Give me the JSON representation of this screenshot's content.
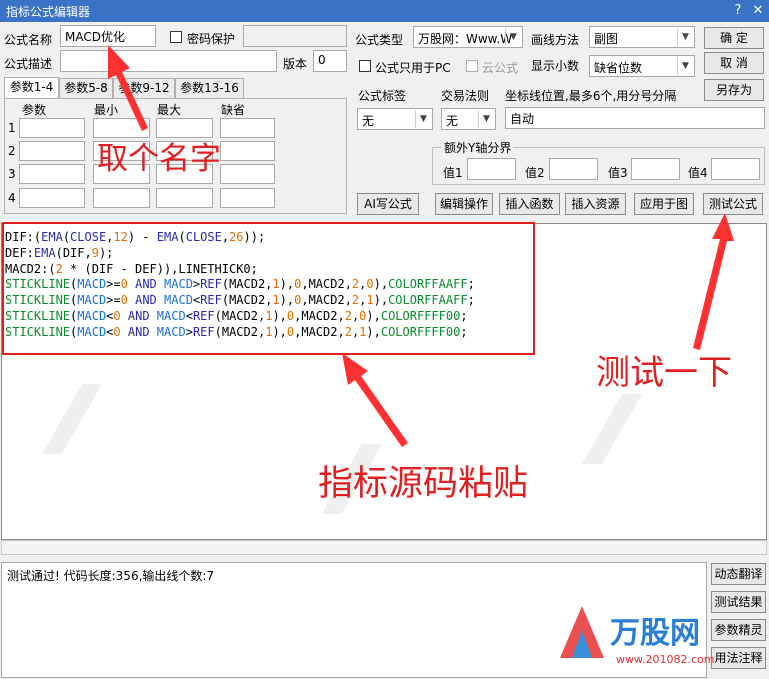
{
  "window": {
    "title": "指标公式编辑器",
    "help_icon": "?",
    "close_icon": "✕"
  },
  "header": {
    "name_label": "公式名称",
    "name_value": "MACD优化",
    "password_label": "密码保护",
    "desc_label": "公式描述",
    "version_label": "版本",
    "version_value": "0",
    "type_label": "公式类型",
    "type_value": "万股网：Www.W",
    "draw_label": "画线方法",
    "draw_value": "副图",
    "pc_only_label": "公式只用于PC",
    "cloud_label": "云公式",
    "decimals_label": "显示小数",
    "decimals_value": "缺省位数"
  },
  "buttons": {
    "ok": "确  定",
    "cancel": "取  消",
    "save_as": "另存为"
  },
  "tabs": [
    "参数1-4",
    "参数5-8",
    "参数9-12",
    "参数13-16"
  ],
  "params": {
    "headers": [
      "参数",
      "最小",
      "最大",
      "缺省"
    ],
    "rows": [
      "1",
      "2",
      "3",
      "4"
    ]
  },
  "options": {
    "tag_label": "公式标签",
    "tag_value": "无",
    "rule_label": "交易法则",
    "rule_value": "无",
    "coord_label": "坐标线位置,最多6个,用分号分隔",
    "coord_value": "自动",
    "extra_y_label": "额外Y轴分界",
    "vals": [
      "值1",
      "值2",
      "值3",
      "值4"
    ]
  },
  "toolbar": [
    "AI写公式",
    "编辑操作",
    "插入函数",
    "插入资源",
    "应用于图",
    "测试公式"
  ],
  "status_text": "测试通过! 代码长度:356,输出线个数:7",
  "side_buttons": [
    "动态翻译",
    "测试结果",
    "参数精灵",
    "用法注释"
  ],
  "annotations": {
    "name": "取个名字",
    "test": "测试一下",
    "paste": "指标源码粘贴"
  },
  "watermark": {
    "brand": "万股网",
    "url": "www.201082.com"
  },
  "colors": {
    "title_bar": "#3a73c6",
    "annotation": "#e02020"
  }
}
